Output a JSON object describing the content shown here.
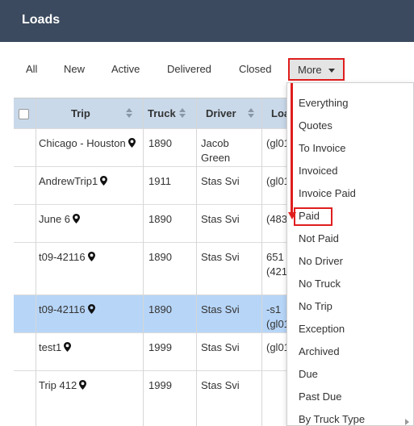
{
  "header": {
    "title": "Loads"
  },
  "tabs": [
    {
      "label": "All"
    },
    {
      "label": "New"
    },
    {
      "label": "Active"
    },
    {
      "label": "Delivered"
    },
    {
      "label": "Closed"
    },
    {
      "label": "More",
      "selected": true
    }
  ],
  "table": {
    "columns": [
      "Trip",
      "Truck",
      "Driver",
      "Loa"
    ],
    "rows": [
      {
        "trip": "Chicago - Houston",
        "truck": "1890",
        "driver": [
          "Jacob",
          "Green"
        ],
        "load": [
          "(gl01",
          ""
        ],
        "selected": false
      },
      {
        "trip": "AndrewTrip1",
        "truck": "1911",
        "driver": [
          "Stas Svi",
          ""
        ],
        "load": [
          "(gl01",
          ""
        ],
        "selected": false
      },
      {
        "trip": "June 6",
        "truck": "1890",
        "driver": [
          "Stas Svi",
          ""
        ],
        "load": [
          "(483",
          ""
        ],
        "selected": false
      },
      {
        "trip": "t09-42116",
        "truck": "1890",
        "driver": [
          "Stas Svi",
          ""
        ],
        "load": [
          "651",
          "(421)"
        ],
        "selected": false
      },
      {
        "trip": "t09-42116",
        "truck": "1890",
        "driver": [
          "Stas Svi",
          ""
        ],
        "load": [
          "-s1",
          "(gl01"
        ],
        "selected": true
      },
      {
        "trip": "test1",
        "truck": "1999",
        "driver": [
          "Stas Svi",
          ""
        ],
        "load": [
          "(gl01",
          ""
        ],
        "selected": false
      },
      {
        "trip": "Trip 412",
        "truck": "1999",
        "driver": [
          "Stas Svi",
          ""
        ],
        "load": [
          "",
          ""
        ],
        "selected": false
      }
    ]
  },
  "dropdown": {
    "items": [
      {
        "label": "Everything"
      },
      {
        "label": "Quotes"
      },
      {
        "label": "To Invoice"
      },
      {
        "label": "Invoiced"
      },
      {
        "label": "Invoice Paid"
      },
      {
        "label": "Paid",
        "highlighted": true
      },
      {
        "label": "Not Paid"
      },
      {
        "label": "No Driver"
      },
      {
        "label": "No Truck"
      },
      {
        "label": "No Trip"
      },
      {
        "label": "Exception"
      },
      {
        "label": "Archived"
      },
      {
        "label": "Due"
      },
      {
        "label": "Past Due"
      },
      {
        "label": "By Truck Type",
        "has_submenu": true
      }
    ]
  },
  "colors": {
    "header_bg": "#3b4a5e",
    "table_header_bg": "#c9d9ea",
    "selected_row_bg": "#b7d5f7",
    "highlight": "#e01e1e"
  }
}
